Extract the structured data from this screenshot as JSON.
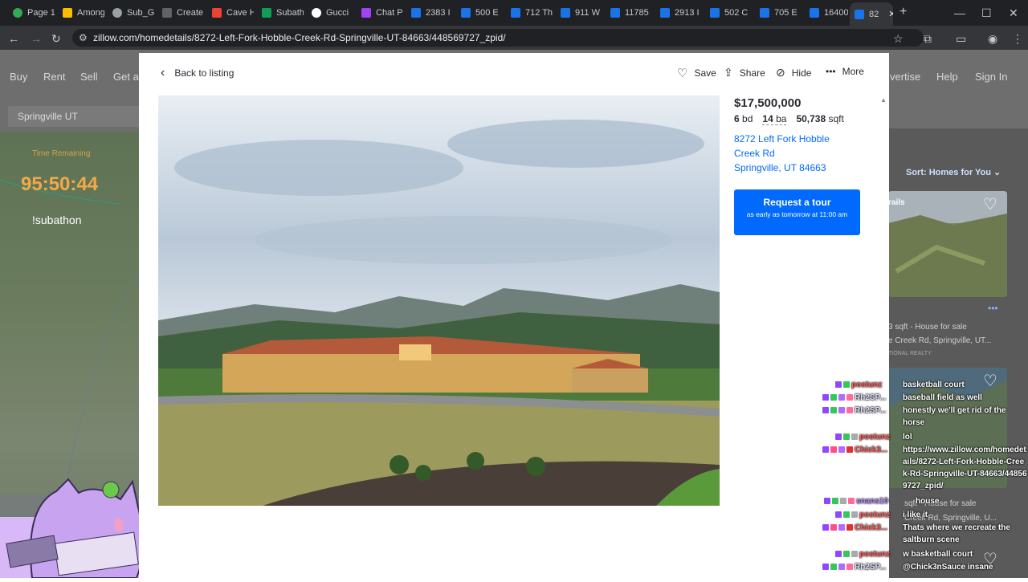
{
  "browser": {
    "tabs": [
      {
        "label": "Page 1",
        "color": "#34a853"
      },
      {
        "label": "Among",
        "color": "#fbbc04"
      },
      {
        "label": "Sub_G",
        "color": "#9aa0a6"
      },
      {
        "label": "Create",
        "color": "#5f6368"
      },
      {
        "label": "Cave H",
        "color": "#ea4335"
      },
      {
        "label": "Subath",
        "color": "#0f9d58"
      },
      {
        "label": "Gucci",
        "color": "#ffffff"
      },
      {
        "label": "Chat P",
        "color": "#a142f4"
      },
      {
        "label": "2383 I",
        "color": "#1a73e8"
      },
      {
        "label": "500 E",
        "color": "#1a73e8"
      },
      {
        "label": "712 Th",
        "color": "#1a73e8"
      },
      {
        "label": "911 W",
        "color": "#1a73e8"
      },
      {
        "label": "11785",
        "color": "#1a73e8"
      },
      {
        "label": "2913 I",
        "color": "#1a73e8"
      },
      {
        "label": "502 C",
        "color": "#1a73e8"
      },
      {
        "label": "705 E",
        "color": "#1a73e8"
      },
      {
        "label": "16400",
        "color": "#1a73e8"
      },
      {
        "label": "82",
        "color": "#1a73e8"
      }
    ],
    "url": "zillow.com/homedetails/8272-Left-Fork-Hobble-Creek-Rd-Springville-UT-84663/448569727_zpid/"
  },
  "zillow_nav": {
    "left": [
      "Buy",
      "Rent",
      "Sell",
      "Get a"
    ],
    "right": [
      "vertise",
      "Help",
      "Sign In"
    ],
    "search_value": "Springville UT",
    "sort_label": "Sort: Homes for You"
  },
  "overlay": {
    "timer_label": "Time Remaining",
    "timer": "95:50:44",
    "subathon_label": "!subathon"
  },
  "modal": {
    "back_label": "Back to listing",
    "actions": {
      "save": "Save",
      "share": "Share",
      "hide": "Hide",
      "more": "More"
    },
    "price": "$17,500,000",
    "beds_value": "6",
    "beds_unit": "bd",
    "baths_value": "14",
    "baths_unit": "ba",
    "sqft_value": "50,738",
    "sqft_unit": "sqft",
    "address_line1": "8272 Left Fork Hobble",
    "address_line2": "Creek Rd",
    "address_line3": "Springville, UT 84663",
    "tour_title": "Request a tour",
    "tour_subtitle": "as early as tomorrow at 11:00 am"
  },
  "side_listings": {
    "card1_tag": "rails",
    "card1_line1": "3 sqft - House for sale",
    "card1_line2": "e Creek Rd, Springville, UT...",
    "card1_line3": "TIONAL REALTY",
    "card2_line1": "sqft - House for sale",
    "card2_line2": "Creek Rd, Springville, U..."
  },
  "chat": [
    {
      "user": "postunz",
      "msg": "basketball court",
      "color": "red"
    },
    {
      "user": "Rh2SP...",
      "msg": "baseball field as well",
      "color": "normal"
    },
    {
      "user": "Rh2SP...",
      "msg": "honestly we'll get rid of the horse",
      "color": "normal"
    },
    {
      "user": "postunz",
      "msg": "lol",
      "color": "red"
    },
    {
      "user": "Chick3...",
      "msg": "https://www.zillow.com/homedetails/8272-Left-Fork-Hobble-Creek-Rd-Springville-UT-84663/448569727_zpid/",
      "color": "red"
    },
    {
      "user": "snans10",
      "msg": "house",
      "color": "purple"
    },
    {
      "user": "postunz",
      "msg": "i like it",
      "color": "red"
    },
    {
      "user": "Chick3...",
      "msg": "Thats where we recreate the saltburn scene",
      "color": "red"
    },
    {
      "user": "postunz",
      "msg": "w basketball court",
      "color": "red"
    },
    {
      "user": "Rh2SP...",
      "msg": "@Chick3nSauce insane",
      "color": "normal"
    }
  ]
}
